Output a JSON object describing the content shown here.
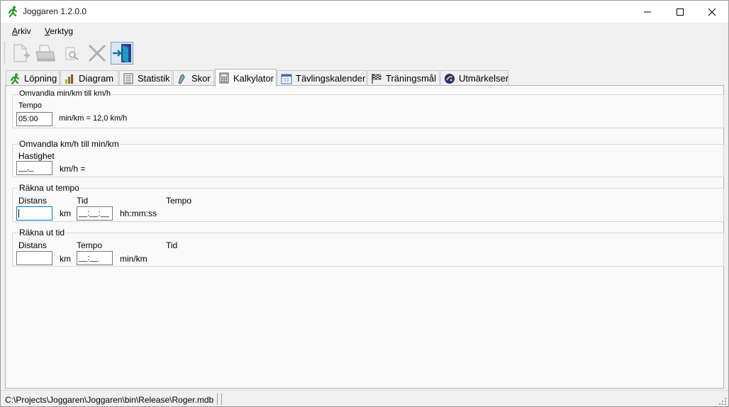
{
  "window": {
    "title": "Joggaren 1.2.0.0",
    "controls": {
      "minimize": "minimize",
      "maximize": "maximize",
      "close": "close"
    }
  },
  "menu": [
    {
      "label": "Arkiv"
    },
    {
      "label": "Verktyg"
    }
  ],
  "toolbar": {
    "buttons": [
      {
        "icon": "new-document-icon",
        "enabled": false
      },
      {
        "icon": "printer-icon",
        "enabled": false
      },
      {
        "icon": "print-preview-icon",
        "enabled": false
      },
      {
        "icon": "delete-icon",
        "enabled": false
      },
      {
        "icon": "exit-door-icon",
        "enabled": true
      }
    ]
  },
  "tabs": [
    {
      "label": "Löpning",
      "icon": "runner-icon"
    },
    {
      "label": "Diagram",
      "icon": "bar-chart-icon"
    },
    {
      "label": "Statistik",
      "icon": "list-icon"
    },
    {
      "label": "Skor",
      "icon": "shoe-icon"
    },
    {
      "label": "Kalkylator",
      "icon": "calculator-icon",
      "active": true
    },
    {
      "label": "Tävlingskalender",
      "icon": "calendar-icon"
    },
    {
      "label": "Träningsmål",
      "icon": "checkered-flag-icon"
    },
    {
      "label": "Utmärkelser",
      "icon": "medal-icon"
    }
  ],
  "calculator": {
    "pace_to_speed": {
      "title": "Omvandla min/km till km/h",
      "label": "Tempo",
      "value": "05:00",
      "result": "min/km = 12,0 km/h"
    },
    "speed_to_pace": {
      "title": "Omvandla km/h till min/km",
      "label": "Hastighet",
      "value": "__,_",
      "result": "km/h ="
    },
    "calc_pace": {
      "title": "Räkna ut tempo",
      "distance_label": "Distans",
      "time_label": "Tid",
      "pace_label": "Tempo",
      "distance_value": "",
      "km_unit": "km",
      "time_value": "__:__:__",
      "time_format": "hh:mm:ss"
    },
    "calc_time": {
      "title": "Räkna ut tid",
      "distance_label": "Distans",
      "pace_label": "Tempo",
      "time_label": "Tid",
      "distance_value": "",
      "km_unit": "km",
      "pace_value": "__:__",
      "pace_unit": "min/km"
    }
  },
  "status": {
    "path": "C:\\Projects\\Joggaren\\Joggaren\\bin\\Release\\Roger.mdb"
  }
}
